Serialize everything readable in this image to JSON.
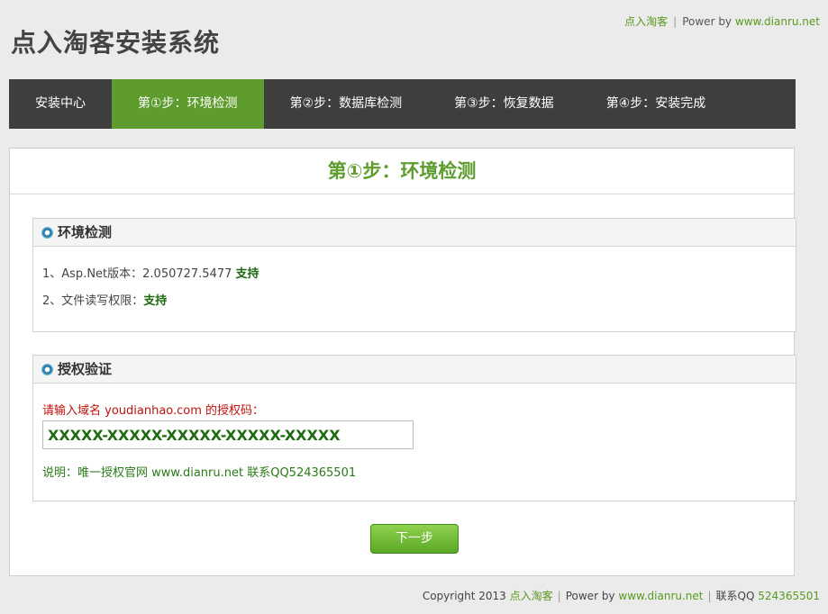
{
  "top_links": {
    "brand": "点入淘客",
    "separator": "|",
    "power_by": "Power by",
    "site": "www.dianru.net"
  },
  "site_title": "点入淘客安装系统",
  "nav": {
    "items": [
      {
        "label": "安装中心"
      },
      {
        "label": "第①步：环境检测"
      },
      {
        "label": "第②步：数据库检测"
      },
      {
        "label": "第③步：恢复数据"
      },
      {
        "label": "第④步：安装完成"
      }
    ]
  },
  "main": {
    "title": "第①步：环境检测",
    "env_box": {
      "title": "环境检测",
      "line1_prefix": "1、Asp.Net版本：2.050727.5477",
      "line1_status": "支持",
      "line2_prefix": "2、文件读写权限：",
      "line2_status": "支持"
    },
    "auth_box": {
      "title": "授权验证",
      "prompt": "请输入域名 youdianhao.com 的授权码：",
      "code_value": "XXXXX-XXXXX-XXXXX-XXXXX-XXXXX",
      "note": "说明：唯一授权官网 www.dianru.net 联系QQ524365501"
    },
    "next_label": "下一步"
  },
  "footer": {
    "copyright": "Copyright 2013",
    "brand": "点入淘客",
    "separator": "|",
    "power_by": "Power by",
    "site": "www.dianru.net",
    "contact_label": "联系QQ",
    "contact_number": "524365501"
  },
  "colors": {
    "accent_green": "#5e9c2e",
    "nav_bg": "#3e3e3e",
    "ok_green": "#1e6b10",
    "prompt_red": "#c0120c"
  }
}
